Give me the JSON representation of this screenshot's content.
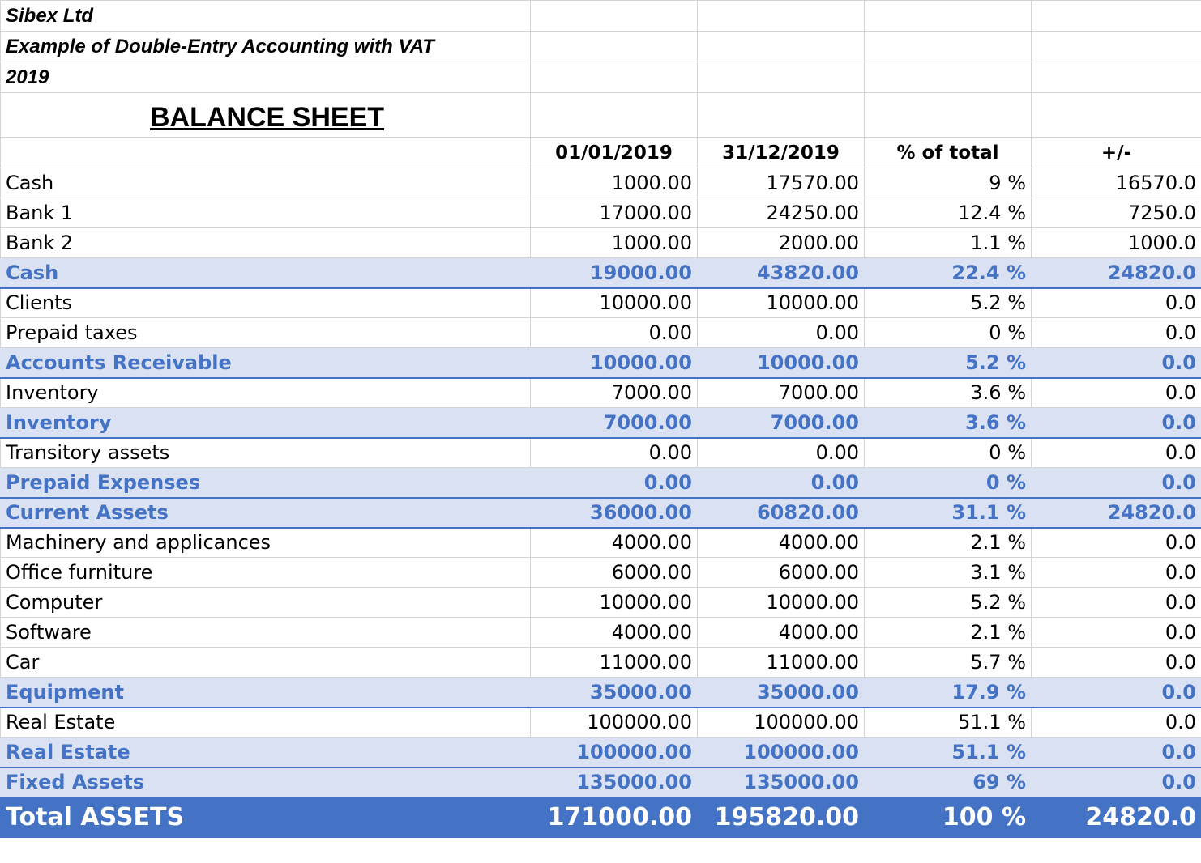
{
  "header": {
    "company": "Sibex Ltd",
    "subtitle": "Example of Double-Entry Accounting with VAT",
    "year": "2019",
    "sheet_title": "BALANCE SHEET"
  },
  "columns": {
    "date_start": "01/01/2019",
    "date_end": "31/12/2019",
    "pct": "% of total",
    "diff": "+/-"
  },
  "rows": [
    {
      "type": "item",
      "label": "Cash",
      "start": "1000.00",
      "end": "17570.00",
      "pct": "9 %",
      "diff": "16570.0"
    },
    {
      "type": "item",
      "label": "Bank 1",
      "start": "17000.00",
      "end": "24250.00",
      "pct": "12.4 %",
      "diff": "7250.0"
    },
    {
      "type": "item",
      "label": "Bank 2",
      "start": "1000.00",
      "end": "2000.00",
      "pct": "1.1 %",
      "diff": "1000.0"
    },
    {
      "type": "sub",
      "label": "Cash",
      "start": "19000.00",
      "end": "43820.00",
      "pct": "22.4 %",
      "diff": "24820.0"
    },
    {
      "type": "item",
      "label": "Clients",
      "start": "10000.00",
      "end": "10000.00",
      "pct": "5.2 %",
      "diff": "0.0"
    },
    {
      "type": "item",
      "label": "Prepaid taxes",
      "start": "0.00",
      "end": "0.00",
      "pct": "0 %",
      "diff": "0.0"
    },
    {
      "type": "sub",
      "label": "Accounts Receivable",
      "start": "10000.00",
      "end": "10000.00",
      "pct": "5.2 %",
      "diff": "0.0"
    },
    {
      "type": "item",
      "label": "Inventory",
      "start": "7000.00",
      "end": "7000.00",
      "pct": "3.6 %",
      "diff": "0.0"
    },
    {
      "type": "sub",
      "label": "Inventory",
      "start": "7000.00",
      "end": "7000.00",
      "pct": "3.6 %",
      "diff": "0.0"
    },
    {
      "type": "item",
      "label": "Transitory assets",
      "start": "0.00",
      "end": "0.00",
      "pct": "0 %",
      "diff": "0.0"
    },
    {
      "type": "sub",
      "label": "Prepaid Expenses",
      "start": "0.00",
      "end": "0.00",
      "pct": "0 %",
      "diff": "0.0"
    },
    {
      "type": "sub",
      "label": "Current Assets",
      "start": "36000.00",
      "end": "60820.00",
      "pct": "31.1 %",
      "diff": "24820.0"
    },
    {
      "type": "item",
      "label": "Machinery and applicances",
      "start": "4000.00",
      "end": "4000.00",
      "pct": "2.1 %",
      "diff": "0.0"
    },
    {
      "type": "item",
      "label": "Office furniture",
      "start": "6000.00",
      "end": "6000.00",
      "pct": "3.1 %",
      "diff": "0.0"
    },
    {
      "type": "item",
      "label": "Computer",
      "start": "10000.00",
      "end": "10000.00",
      "pct": "5.2 %",
      "diff": "0.0"
    },
    {
      "type": "item",
      "label": "Software",
      "start": "4000.00",
      "end": "4000.00",
      "pct": "2.1 %",
      "diff": "0.0"
    },
    {
      "type": "item",
      "label": "Car",
      "start": "11000.00",
      "end": "11000.00",
      "pct": "5.7 %",
      "diff": "0.0"
    },
    {
      "type": "sub",
      "label": "Equipment",
      "start": "35000.00",
      "end": "35000.00",
      "pct": "17.9 %",
      "diff": "0.0"
    },
    {
      "type": "item",
      "label": "Real Estate",
      "start": "100000.00",
      "end": "100000.00",
      "pct": "51.1 %",
      "diff": "0.0"
    },
    {
      "type": "sub",
      "label": "Real Estate",
      "start": "100000.00",
      "end": "100000.00",
      "pct": "51.1 %",
      "diff": "0.0"
    },
    {
      "type": "sub",
      "label": "Fixed Assets",
      "start": "135000.00",
      "end": "135000.00",
      "pct": "69 %",
      "diff": "0.0"
    },
    {
      "type": "total",
      "label": "Total ASSETS",
      "start": "171000.00",
      "end": "195820.00",
      "pct": "100 %",
      "diff": "24820.0"
    }
  ],
  "colors": {
    "subtotal_bg": "#d9e1f2",
    "subtotal_text": "#4472c4",
    "total_bg": "#4472c4",
    "total_text": "#ffffff",
    "gridline": "#d4d4d4"
  }
}
